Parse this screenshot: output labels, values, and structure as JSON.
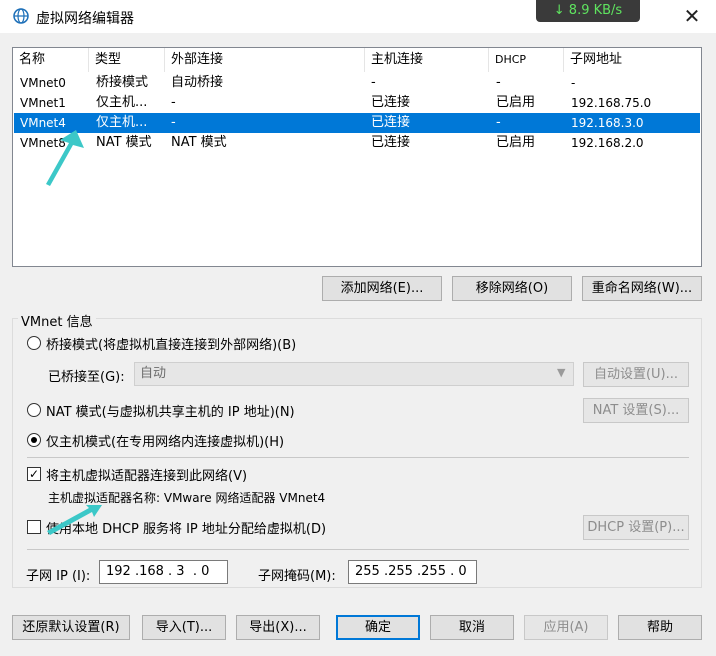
{
  "window": {
    "title": "虚拟网络编辑器",
    "speed": "↓ 8.9 KB/s",
    "close_glyph": "✕"
  },
  "columns": [
    "名称",
    "类型",
    "外部连接",
    "主机连接",
    "DHCP",
    "子网地址"
  ],
  "networks": [
    {
      "name": "VMnet0",
      "type": "桥接模式",
      "external": "自动桥接",
      "host": "-",
      "dhcp": "-",
      "subnet": "-",
      "selected": false
    },
    {
      "name": "VMnet1",
      "type": "仅主机...",
      "external": "-",
      "host": "已连接",
      "dhcp": "已启用",
      "subnet": "192.168.75.0",
      "selected": false
    },
    {
      "name": "VMnet4",
      "type": "仅主机...",
      "external": "-",
      "host": "已连接",
      "dhcp": "-",
      "subnet": "192.168.3.0",
      "selected": true
    },
    {
      "name": "VMnet8",
      "type": "NAT 模式",
      "external": "NAT 模式",
      "host": "已连接",
      "dhcp": "已启用",
      "subnet": "192.168.2.0",
      "selected": false
    }
  ],
  "list_buttons": {
    "add": "添加网络(E)...",
    "remove": "移除网络(O)",
    "rename": "重命名网络(W)..."
  },
  "info": {
    "group_label": "VMnet 信息",
    "bridged_label": "桥接模式(将虚拟机直接连接到外部网络)(B)",
    "bridged_to_label": "已桥接至(G):",
    "bridged_to_value": "自动",
    "auto_settings": "自动设置(U)...",
    "nat_label": "NAT 模式(与虚拟机共享主机的 IP 地址)(N)",
    "nat_settings": "NAT 设置(S)...",
    "host_only_label": "仅主机模式(在专用网络内连接虚拟机)(H)",
    "mode_selected": "host_only",
    "connect_adapter_label": "将主机虚拟适配器连接到此网络(V)",
    "connect_adapter_checked": true,
    "adapter_name_text": "主机虚拟适配器名称: VMware 网络适配器 VMnet4",
    "dhcp_label": "使用本地 DHCP 服务将 IP 地址分配给虚拟机(D)",
    "dhcp_checked": false,
    "dhcp_settings": "DHCP 设置(P)...",
    "subnet_ip_label": "子网 IP (I):",
    "subnet_ip_value": "192 .168 . 3  . 0",
    "subnet_mask_label": "子网掩码(M):",
    "subnet_mask_value": "255 .255 .255 . 0"
  },
  "footer": {
    "restore": "还原默认设置(R)",
    "import": "导入(T)...",
    "export": "导出(X)...",
    "ok": "确定",
    "cancel": "取消",
    "apply": "应用(A)",
    "help": "帮助"
  },
  "colors": {
    "selection": "#0078d7",
    "annotation_arrow": "#3cc8c8",
    "speed_text": "#5fe35f"
  }
}
